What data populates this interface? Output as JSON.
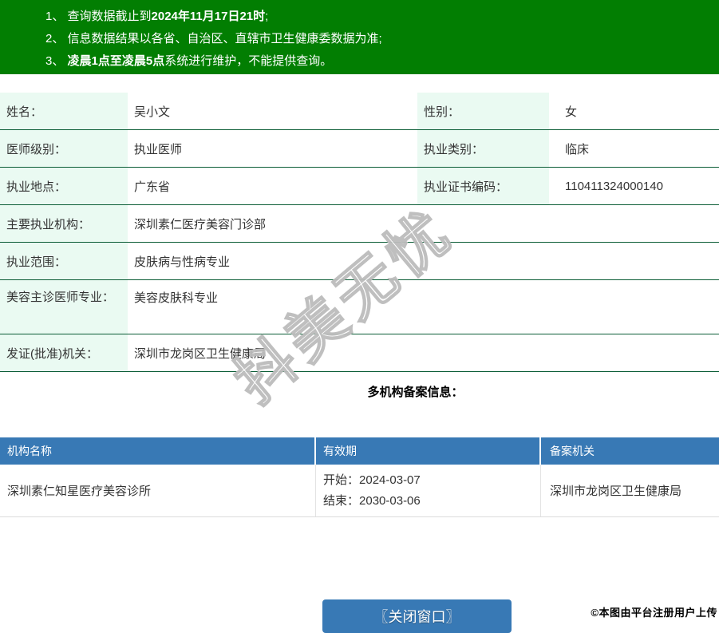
{
  "notices": [
    {
      "num": "1、 ",
      "pre": "查询数据截止到",
      "bold": "2024年11月17日21时",
      "post": ";"
    },
    {
      "num": "2、 ",
      "pre": "信息数据结果以各省、自治区、直辖市卫生健康委数据为准;",
      "bold": "",
      "post": ""
    },
    {
      "num": "3、 ",
      "pre": "",
      "bold": "凌晨1点至凌晨5点",
      "post": "系统进行维护，不能提供查询。"
    }
  ],
  "info": {
    "rows2": [
      {
        "l1": "姓名：",
        "v1": "吴小文",
        "l2": "性别：",
        "v2": "女"
      },
      {
        "l1": "医师级别：",
        "v1": "执业医师",
        "l2": "执业类别：",
        "v2": "临床"
      },
      {
        "l1": "执业地点：",
        "v1": "广东省",
        "l2": "执业证书编码：",
        "v2": "110411324000140"
      }
    ],
    "rows1": [
      {
        "l": "主要执业机构：",
        "v": "深圳素仁医疗美容门诊部"
      },
      {
        "l": "执业范围：",
        "v": "皮肤病与性病专业"
      },
      {
        "l": "美容主诊医师专业：",
        "v": "美容皮肤科专业"
      },
      {
        "l": "发证(批准)机关：",
        "v": "深圳市龙岗区卫生健康局"
      }
    ]
  },
  "section_title": "多机构备案信息：",
  "filing_table": {
    "headers": [
      "机构名称",
      "有效期",
      "备案机关"
    ],
    "rows": [
      {
        "org": "深圳素仁知星医疗美容诊所",
        "start_label": "开始：",
        "start_date": "2024-03-07",
        "end_label": "结束：",
        "end_date": "2030-03-06",
        "authority": "深圳市龙岗区卫生健康局"
      }
    ]
  },
  "close_button": "〖关闭窗口〗",
  "watermark": "抖美无忧",
  "footer_credit": "©本图由平台注册用户上传",
  "colors": {
    "notice_bg": "#027e02",
    "label_bg": "#eafaf2",
    "row_border": "#0b5d36",
    "table_header_bg": "#3879b5",
    "button_bg": "#3879b5"
  }
}
